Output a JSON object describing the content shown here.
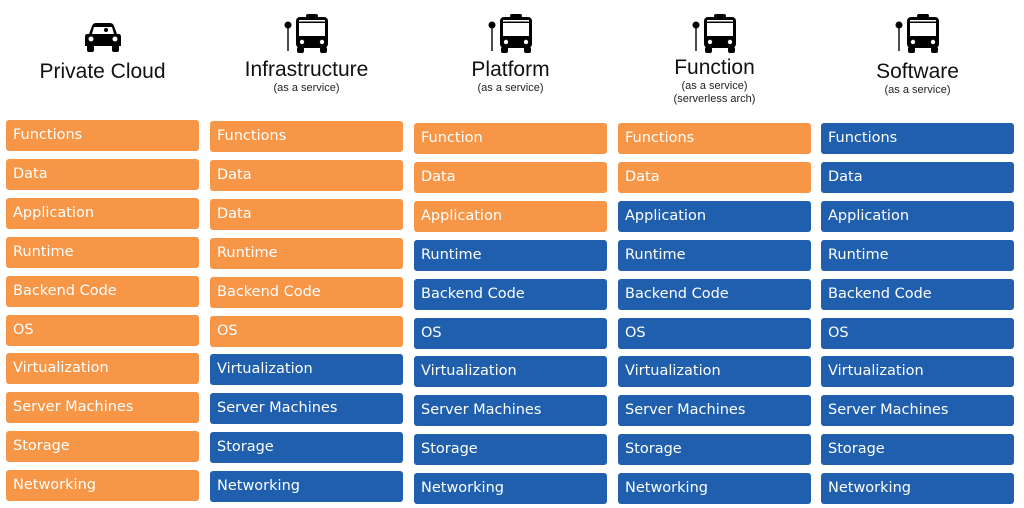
{
  "colors": {
    "managed_by_user": "#f79646",
    "managed_by_provider": "#1f5fae"
  },
  "columns": [
    {
      "title": "Private Cloud",
      "subtitles": [],
      "icon": "car-icon",
      "rows": [
        {
          "label": "Functions",
          "color": "orange"
        },
        {
          "label": "Data",
          "color": "orange"
        },
        {
          "label": "Application",
          "color": "orange"
        },
        {
          "label": "Runtime",
          "color": "orange"
        },
        {
          "label": "Backend Code",
          "color": "orange"
        },
        {
          "label": "OS",
          "color": "orange"
        },
        {
          "label": "Virtualization",
          "color": "orange"
        },
        {
          "label": "Server Machines",
          "color": "orange"
        },
        {
          "label": "Storage",
          "color": "orange"
        },
        {
          "label": "Networking",
          "color": "orange"
        }
      ]
    },
    {
      "title": "Infrastructure",
      "subtitles": [
        "(as a service)"
      ],
      "icon": "bus-stop-icon",
      "rows": [
        {
          "label": "Functions",
          "color": "orange"
        },
        {
          "label": "Data",
          "color": "orange"
        },
        {
          "label": "Data",
          "color": "orange"
        },
        {
          "label": "Runtime",
          "color": "orange"
        },
        {
          "label": "Backend Code",
          "color": "orange"
        },
        {
          "label": "OS",
          "color": "orange"
        },
        {
          "label": "Virtualization",
          "color": "blue"
        },
        {
          "label": "Server Machines",
          "color": "blue"
        },
        {
          "label": "Storage",
          "color": "blue"
        },
        {
          "label": "Networking",
          "color": "blue"
        }
      ]
    },
    {
      "title": "Platform",
      "subtitles": [
        "(as a service)"
      ],
      "icon": "bus-stop-icon",
      "rows": [
        {
          "label": "Function",
          "color": "orange"
        },
        {
          "label": "Data",
          "color": "orange"
        },
        {
          "label": "Application",
          "color": "orange"
        },
        {
          "label": "Runtime",
          "color": "blue"
        },
        {
          "label": "Backend Code",
          "color": "blue"
        },
        {
          "label": "OS",
          "color": "blue"
        },
        {
          "label": "Virtualization",
          "color": "blue"
        },
        {
          "label": "Server Machines",
          "color": "blue"
        },
        {
          "label": "Storage",
          "color": "blue"
        },
        {
          "label": "Networking",
          "color": "blue"
        }
      ]
    },
    {
      "title": "Function",
      "subtitles": [
        "(as a service)",
        "(serverless arch)"
      ],
      "icon": "bus-stop-icon",
      "rows": [
        {
          "label": "Functions",
          "color": "orange"
        },
        {
          "label": "Data",
          "color": "orange"
        },
        {
          "label": "Application",
          "color": "blue"
        },
        {
          "label": "Runtime",
          "color": "blue"
        },
        {
          "label": "Backend Code",
          "color": "blue"
        },
        {
          "label": "OS",
          "color": "blue"
        },
        {
          "label": "Virtualization",
          "color": "blue"
        },
        {
          "label": "Server Machines",
          "color": "blue"
        },
        {
          "label": "Storage",
          "color": "blue"
        },
        {
          "label": "Networking",
          "color": "blue"
        }
      ]
    },
    {
      "title": "Software",
      "subtitles": [
        "(as a service)"
      ],
      "icon": "bus-stop-icon",
      "rows": [
        {
          "label": "Functions",
          "color": "blue"
        },
        {
          "label": "Data",
          "color": "blue"
        },
        {
          "label": "Application",
          "color": "blue"
        },
        {
          "label": "Runtime",
          "color": "blue"
        },
        {
          "label": "Backend Code",
          "color": "blue"
        },
        {
          "label": "OS",
          "color": "blue"
        },
        {
          "label": "Virtualization",
          "color": "blue"
        },
        {
          "label": "Server Machines",
          "color": "blue"
        },
        {
          "label": "Storage",
          "color": "blue"
        },
        {
          "label": "Networking",
          "color": "blue"
        }
      ]
    }
  ]
}
